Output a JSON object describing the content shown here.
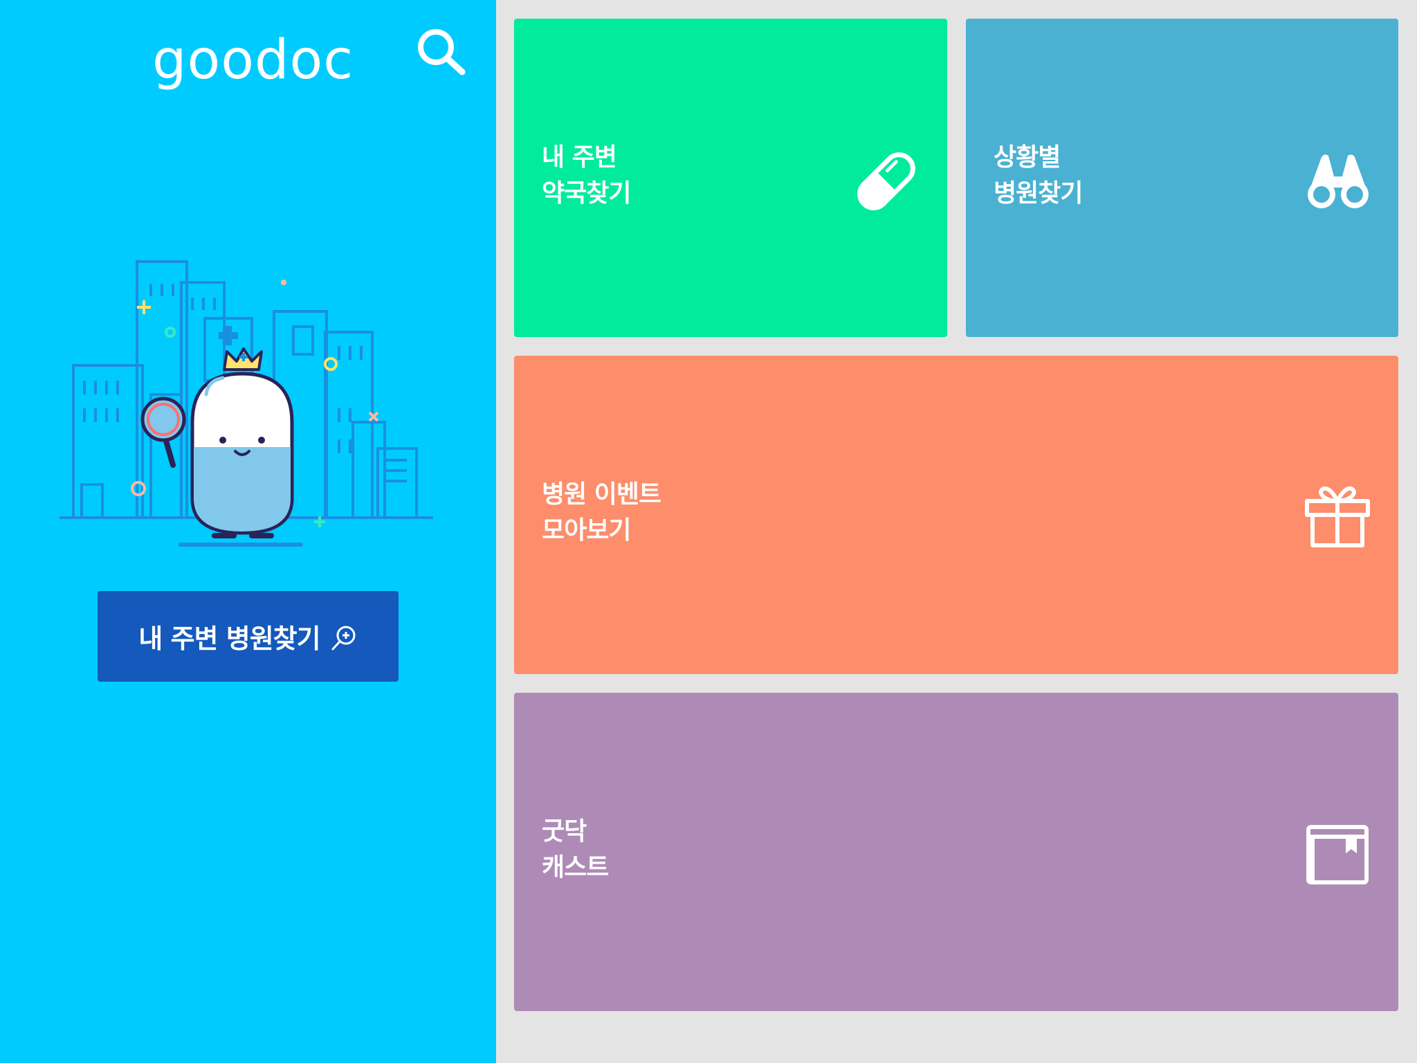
{
  "app": {
    "logo": "goodoc",
    "colors": {
      "left_panel": "#00cbff",
      "primary_button": "#1459bb",
      "background": "#e4e4e4"
    }
  },
  "left_panel": {
    "search_icon": "search-icon",
    "illustration": "pill-mascot-city-illustration",
    "nearby_hospital_button": {
      "label": "내 주변 병원찾기",
      "icon": "zoom-in-icon"
    }
  },
  "tiles": [
    {
      "id": "pharmacy",
      "line1": "내 주변",
      "line2": "약국찾기",
      "icon": "pill-icon",
      "color": "#00eb9b"
    },
    {
      "id": "situation",
      "line1": "상황별",
      "line2": "병원찾기",
      "icon": "binoculars-icon",
      "color": "#4ab1d2"
    },
    {
      "id": "events",
      "line1": "병원 이벤트",
      "line2": "모아보기",
      "icon": "gift-icon",
      "color": "#fd8d6b"
    },
    {
      "id": "cast",
      "line1": "굿닥",
      "line2": "캐스트",
      "icon": "book-icon",
      "color": "#ae8bb6"
    }
  ]
}
